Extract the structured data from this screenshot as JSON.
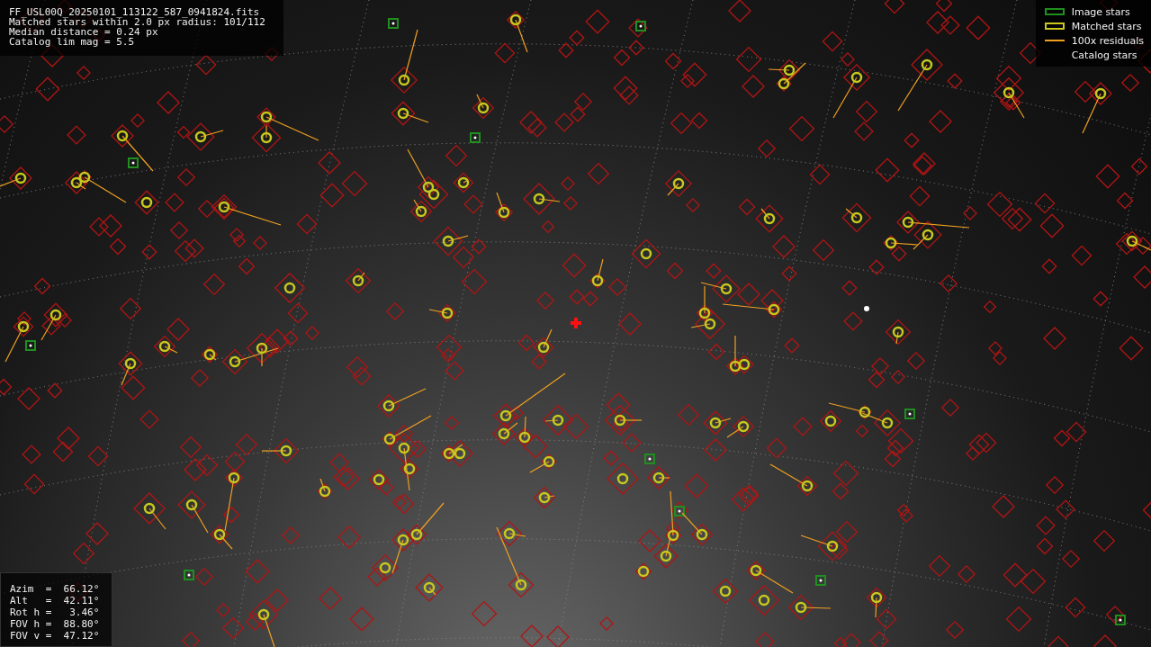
{
  "info": {
    "lines": [
      "FF_USL00Q_20250101_113122_587_0941824.fits",
      "Matched stars within 2.0 px radius: 101/112",
      "Median distance = 0.24 px",
      "Catalog lim mag = 5.5"
    ]
  },
  "legend": [
    {
      "kind": "box",
      "color": "#1f8f1f",
      "label": "Image stars"
    },
    {
      "kind": "box",
      "color": "#c8c81e",
      "label": "Matched stars"
    },
    {
      "kind": "line",
      "color": "#f0a020",
      "label": "100x residuals"
    },
    {
      "kind": "none",
      "label": "Catalog stars"
    }
  ],
  "pointing": {
    "lines": [
      "Azim  =  66.12°",
      "Alt   =  42.11°",
      "Rot h =   3.46°",
      "FOV h =  88.80°",
      "FOV v =  47.12°"
    ]
  }
}
